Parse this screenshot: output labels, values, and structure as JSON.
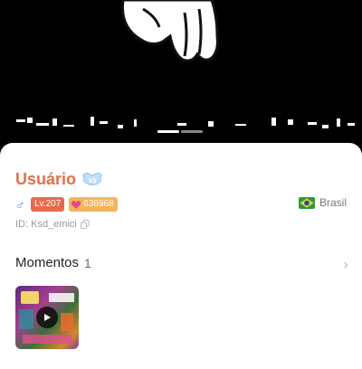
{
  "profile": {
    "username": "Usuário",
    "vip_badge": "V3",
    "gender_icon": "male-symbol",
    "gender_symbol": "♂",
    "level": "Lv.207",
    "wealth_value": "636968",
    "country_name": "Brasil",
    "country_flag_icon": "brazil-flag",
    "id_text": "ID: Ksd_emici"
  },
  "moments": {
    "label": "Momentos",
    "count": "1",
    "chevron": "›"
  },
  "colors": {
    "username": "#e0704a",
    "level_badge": "#e56b4f",
    "wealth_badge": "#f4b55a",
    "vip_badge": "#8fc6f0",
    "gender": "#3b8de0"
  }
}
